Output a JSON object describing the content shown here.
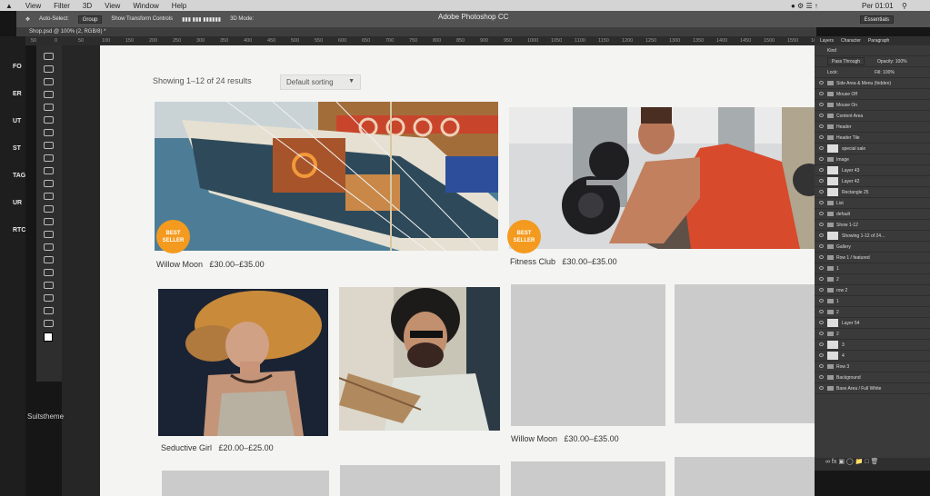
{
  "menubar": {
    "items": [
      "»",
      "View",
      "Filter",
      "3D",
      "View",
      "Window",
      "Help"
    ],
    "app_title": "Adobe Photoshop CC",
    "clock": "Per 01:01"
  },
  "options": {
    "auto_select": "Auto-Select:",
    "group": "Group",
    "show_transform": "Show Transform Controls",
    "mode3d": "3D Mode:",
    "essentials": "Essentials"
  },
  "doc_tab": "Shop.psd @ 100% (2, RGB/8) *",
  "ruler": [
    "50",
    "0",
    "50",
    "100",
    "150",
    "200",
    "250",
    "300",
    "350",
    "400",
    "450",
    "500",
    "550",
    "600",
    "650",
    "700",
    "750",
    "800",
    "850",
    "900",
    "950",
    "1000",
    "1050",
    "1100",
    "1150",
    "1200",
    "1250",
    "1300",
    "1350",
    "1400",
    "1450",
    "1500",
    "1550",
    "1600",
    "1650",
    "1700",
    "1750"
  ],
  "left_letters": [
    "FO",
    "ER",
    "UT",
    "ST",
    "TAG",
    "UR",
    "RTC"
  ],
  "left_bottom": "Suitstheme",
  "shop": {
    "showing": "Showing 1–12 of 24 results",
    "sorting": "Default sorting",
    "products": [
      {
        "title": "Willow Moon",
        "price": "£30.00–£35.00",
        "badge": "BEST SELLER"
      },
      {
        "title": "Fitness Club",
        "price": "£30.00–£35.00",
        "badge": "BEST SELLER"
      },
      {
        "title": "Seductive Girl",
        "price": "£20.00–£25.00"
      },
      {
        "title": "Willow Moon",
        "price": "£30.00–£35.00"
      }
    ]
  },
  "panel": {
    "tabs": [
      "Layers",
      "Character",
      "Paragraph"
    ],
    "kind": "Kind",
    "blend": "Pass Through",
    "opacity": "Opacity: 100%",
    "lock": "Lock:",
    "fill": "Fill: 100%",
    "layers": [
      "Side Area & Menu (hidden)",
      "Mouse Off",
      "Mouse On",
      "Content Area",
      "Header",
      "Header Tile",
      "special sale",
      "Image",
      "Layer 43",
      "Layer 42",
      "Rectangle 25",
      "List",
      "default",
      "Show 1-12",
      "Showing 1-12 of 24...",
      "Gallery",
      "Row 1 / featured",
      "1",
      "2",
      "row 2",
      "1",
      "2",
      "Layer 54",
      "2",
      "3",
      "4",
      "Row 3",
      "Background",
      "Base Area / Full White"
    ]
  },
  "colors": {
    "badge": "#f39a1f",
    "page": "#f4f4f2",
    "placeholder": "#cbcbcb"
  }
}
